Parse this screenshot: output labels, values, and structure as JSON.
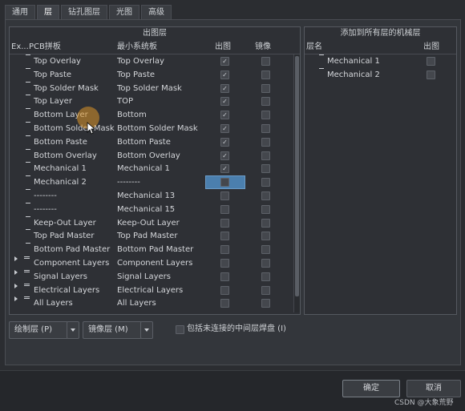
{
  "tabs": [
    "通用",
    "层",
    "钻孔图层",
    "光图",
    "高级"
  ],
  "left_group": {
    "title": "出图层",
    "headers": {
      "ex": "Ex...",
      "pcb": "PCB拼板",
      "min": "最小系统板",
      "plot": "出图",
      "mirror": "镜像"
    },
    "rows": [
      {
        "pcb": "Top Overlay",
        "min": "Top Overlay",
        "plot": true,
        "mirror": false,
        "kind": "leaf"
      },
      {
        "pcb": "Top Paste",
        "min": "Top Paste",
        "plot": true,
        "mirror": false,
        "kind": "leaf"
      },
      {
        "pcb": "Top Solder Mask",
        "min": "Top Solder Mask",
        "plot": true,
        "mirror": false,
        "kind": "leaf"
      },
      {
        "pcb": "Top Layer",
        "min": "TOP",
        "plot": true,
        "mirror": false,
        "kind": "leaf"
      },
      {
        "pcb": "Bottom Layer",
        "min": "Bottom",
        "plot": true,
        "mirror": false,
        "kind": "leaf"
      },
      {
        "pcb": "Bottom Solder Mask",
        "min": "Bottom Solder Mask",
        "plot": true,
        "mirror": false,
        "kind": "leaf"
      },
      {
        "pcb": "Bottom Paste",
        "min": "Bottom Paste",
        "plot": true,
        "mirror": false,
        "kind": "leaf"
      },
      {
        "pcb": "Bottom Overlay",
        "min": "Bottom Overlay",
        "plot": true,
        "mirror": false,
        "kind": "leaf"
      },
      {
        "pcb": "Mechanical 1",
        "min": "Mechanical 1",
        "plot": true,
        "mirror": false,
        "kind": "leaf"
      },
      {
        "pcb": "Mechanical 2",
        "min": "--------",
        "plot": false,
        "mirror": false,
        "kind": "leaf",
        "selected": true
      },
      {
        "pcb": "--------",
        "min": "Mechanical 13",
        "plot": false,
        "mirror": false,
        "kind": "leaf"
      },
      {
        "pcb": "--------",
        "min": "Mechanical 15",
        "plot": false,
        "mirror": false,
        "kind": "leaf"
      },
      {
        "pcb": "Keep-Out Layer",
        "min": "Keep-Out Layer",
        "plot": false,
        "mirror": false,
        "kind": "leaf"
      },
      {
        "pcb": "Top Pad Master",
        "min": "Top Pad Master",
        "plot": false,
        "mirror": false,
        "kind": "leaf"
      },
      {
        "pcb": "Bottom Pad Master",
        "min": "Bottom Pad Master",
        "plot": false,
        "mirror": false,
        "kind": "leaf"
      },
      {
        "pcb": "Component Layers",
        "min": "Component Layers",
        "plot": false,
        "mirror": false,
        "kind": "group"
      },
      {
        "pcb": "Signal Layers",
        "min": "Signal Layers",
        "plot": false,
        "mirror": false,
        "kind": "group"
      },
      {
        "pcb": "Electrical Layers",
        "min": "Electrical Layers",
        "plot": false,
        "mirror": false,
        "kind": "group"
      },
      {
        "pcb": "All Layers",
        "min": "All Layers",
        "plot": false,
        "mirror": false,
        "kind": "group"
      }
    ]
  },
  "right_group": {
    "title": "添加到所有层的机械层",
    "headers": {
      "name": "层名",
      "plot": "出图"
    },
    "rows": [
      {
        "name": "Mechanical 1",
        "plot": false
      },
      {
        "name": "Mechanical 2",
        "plot": false
      }
    ]
  },
  "buttons": {
    "plot_layers": "绘制层 (P)",
    "mirror_layers": "镜像层 (M)",
    "include_unconnected": "包括未连接的中间层焊盘 (I)",
    "ok": "确定",
    "cancel": "取消"
  },
  "check_mark": "✓",
  "watermark": "CSDN @大象荒野"
}
